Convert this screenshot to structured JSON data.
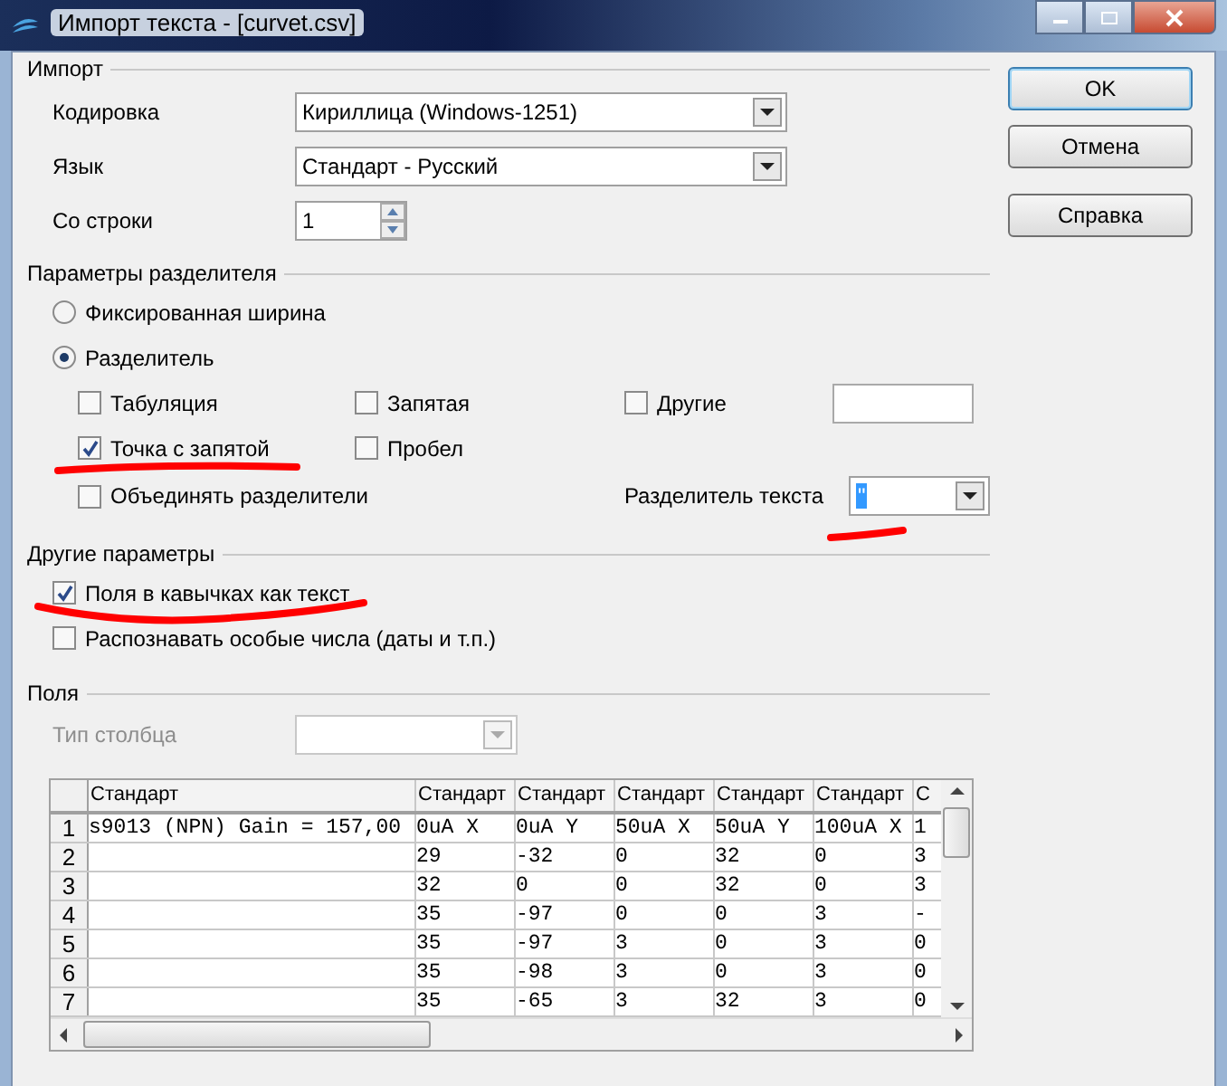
{
  "window": {
    "title": "Импорт текста - [curvet.csv]"
  },
  "import": {
    "title": "Импорт",
    "fields": [
      {
        "kind": "combo",
        "label": "Кодировка",
        "value": "Кириллица (Windows-1251)"
      },
      {
        "kind": "combo",
        "label": "Язык",
        "value": "Стандарт - Русский"
      },
      {
        "kind": "spin",
        "label": "Со строки",
        "value": "1"
      }
    ]
  },
  "separator_options": {
    "title": "Параметры разделителя",
    "modes": [
      {
        "label": "Фиксированная ширина",
        "selected": false
      },
      {
        "label": "Разделитель",
        "selected": true
      }
    ],
    "separators": [
      {
        "label": "Табуляция",
        "checked": false
      },
      {
        "label": "Запятая",
        "checked": false
      },
      {
        "label": "Другие",
        "checked": false
      },
      {
        "label": "Точка с запятой",
        "checked": true
      },
      {
        "label": "Пробел",
        "checked": false
      }
    ],
    "merge": {
      "label": "Объединять разделители",
      "checked": false
    },
    "text_delimiter": {
      "label": "Разделитель текста",
      "value": "\""
    }
  },
  "other_options": {
    "title": "Другие параметры",
    "items": [
      {
        "label": "Поля в кавычках как текст",
        "checked": true
      },
      {
        "label": "Распознавать особые числа (даты и т.п.)",
        "checked": false
      }
    ]
  },
  "fields": {
    "title": "Поля",
    "column_type": {
      "label": "Тип столбца",
      "disabled": true
    },
    "table": {
      "columns": [
        "Стандарт",
        "Стандарт",
        "Стандарт",
        "Стандарт",
        "Стандарт",
        "Стандарт",
        "С"
      ],
      "rows": [
        {
          "number": "1",
          "cells": [
            "s9013 (NPN) Gain = 157,00",
            "0uA X",
            "0uA Y",
            "50uA X",
            "50uA Y",
            "100uA X",
            "1"
          ]
        },
        {
          "number": "2",
          "cells": [
            "",
            "29",
            "-32",
            "0",
            "32",
            "0",
            "3"
          ]
        },
        {
          "number": "3",
          "cells": [
            "",
            "32",
            "0",
            "0",
            "32",
            "0",
            "3"
          ]
        },
        {
          "number": "4",
          "cells": [
            "",
            "35",
            "-97",
            "0",
            "0",
            "3",
            "-"
          ]
        },
        {
          "number": "5",
          "cells": [
            "",
            "35",
            "-97",
            "3",
            "0",
            "3",
            "0"
          ]
        },
        {
          "number": "6",
          "cells": [
            "",
            "35",
            "-98",
            "3",
            "0",
            "3",
            "0"
          ]
        },
        {
          "number": "7",
          "cells": [
            "",
            "35",
            "-65",
            "3",
            "32",
            "3",
            "0"
          ]
        }
      ]
    }
  },
  "buttons": [
    "OK",
    "Отмена",
    "Справка"
  ]
}
